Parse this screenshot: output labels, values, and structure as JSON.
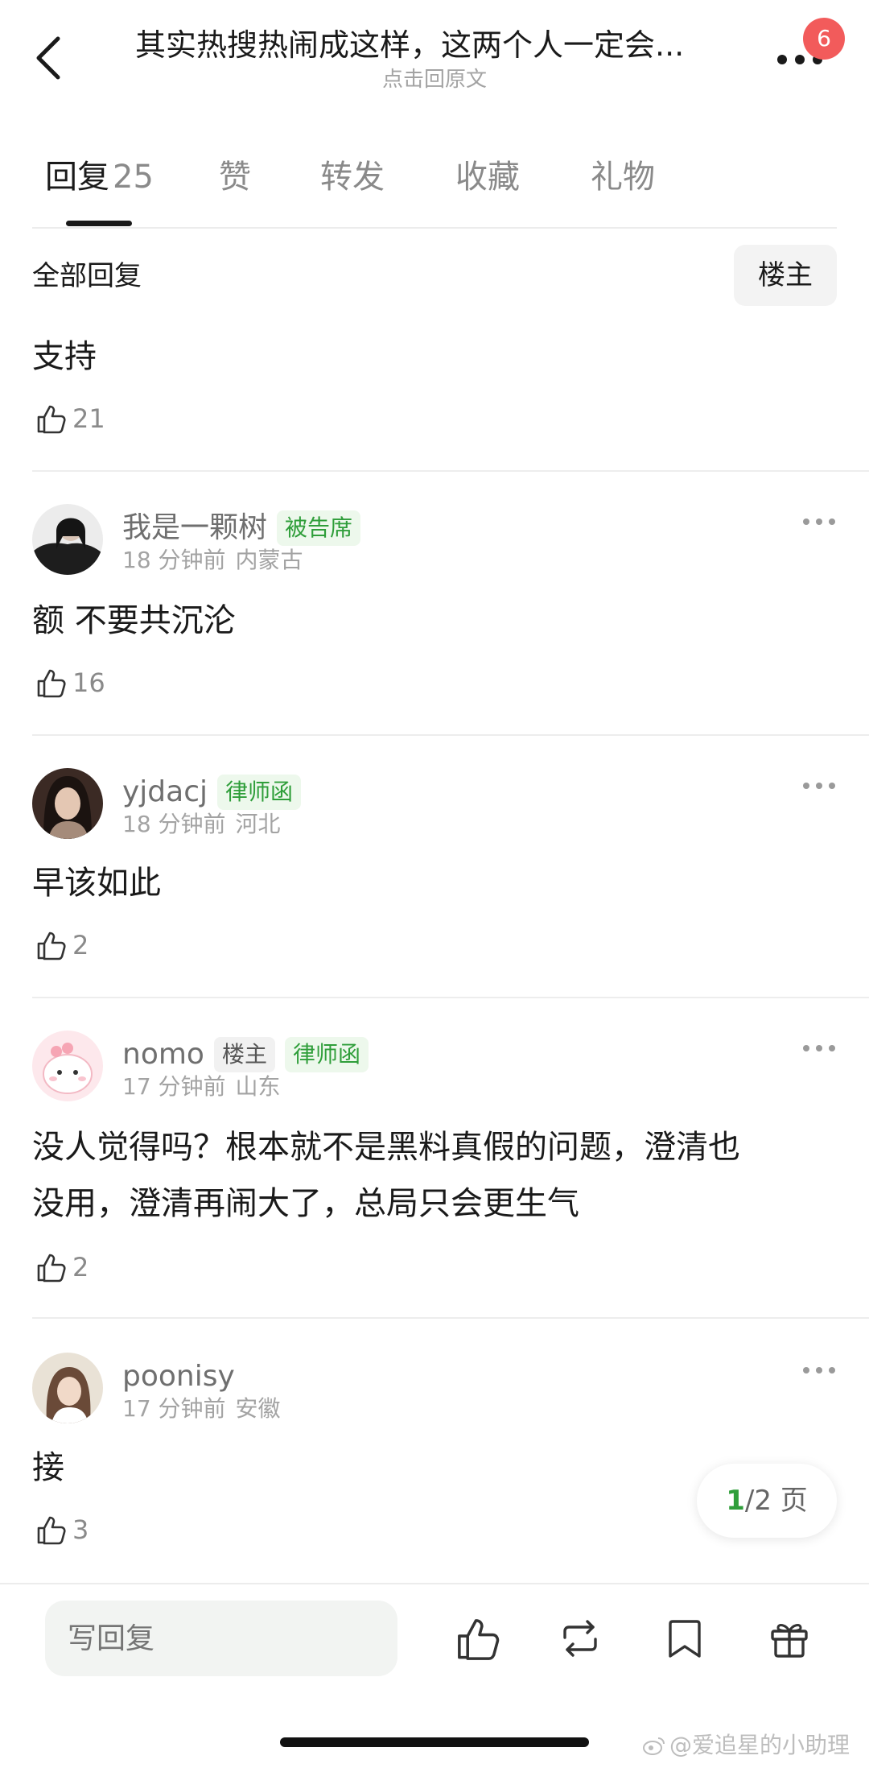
{
  "header": {
    "title": "其实热搜热闹成这样，这两个人一定会...",
    "subtitle": "点击回原文",
    "notification_count": "6"
  },
  "tabs": [
    {
      "label": "回复",
      "count": "25"
    },
    {
      "label": "赞"
    },
    {
      "label": "转发"
    },
    {
      "label": "收藏"
    },
    {
      "label": "礼物"
    }
  ],
  "filter": {
    "label": "全部回复",
    "op_button": "楼主"
  },
  "top_comment": {
    "text": "支持",
    "likes": "21"
  },
  "comments": [
    {
      "username": "我是一颗树",
      "tags": [
        "被告席"
      ],
      "time": "18 分钟前",
      "location": "内蒙古",
      "text": "额 不要共沉沦",
      "likes": "16"
    },
    {
      "username": "yjdacj",
      "tags": [
        "律师函"
      ],
      "time": "18 分钟前",
      "location": "河北",
      "text": "早该如此",
      "likes": "2"
    },
    {
      "username": "nomo",
      "tags": [
        "楼主",
        "律师函"
      ],
      "time": "17 分钟前",
      "location": "山东",
      "text_line1": "没人觉得吗？根本就不是黑料真假的问题，澄清也",
      "text_line2": "没用，澄清再闹大了，总局只会更生气",
      "likes": "2"
    },
    {
      "username": "poonisy",
      "tags": [],
      "time": "17 分钟前",
      "location": "安徽",
      "text": "接",
      "likes": "3"
    }
  ],
  "pagination": {
    "current": "1",
    "rest": "/2 页"
  },
  "bottom_bar": {
    "reply_placeholder": "写回复"
  },
  "watermark": "@爱追星的小助理",
  "colors": {
    "accent_green": "#2f9e3a",
    "badge_red": "#f25b5b",
    "tag_green_bg": "#edf8ec"
  }
}
